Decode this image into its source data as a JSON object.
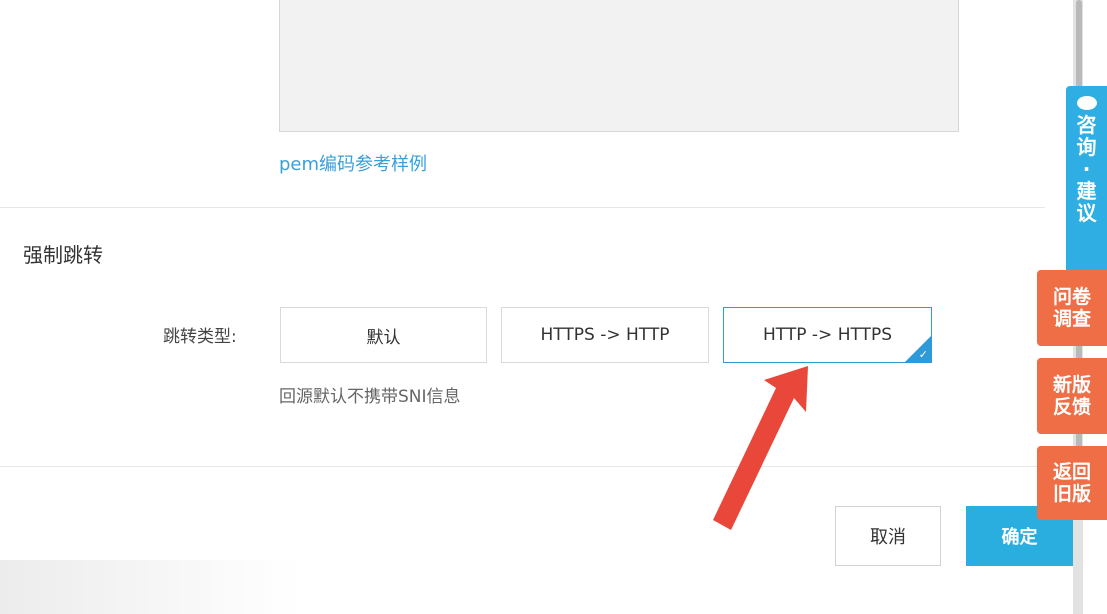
{
  "cert_form": {
    "pem_link": "pem编码参考样例"
  },
  "redirect": {
    "section_title": "强制跳转",
    "type_label": "跳转类型:",
    "options": [
      "默认",
      "HTTPS -> HTTP",
      "HTTP -> HTTPS"
    ],
    "selected": "HTTP -> HTTPS",
    "hint": "回源默认不携带SNI信息"
  },
  "footer": {
    "cancel_label": "取消",
    "ok_label": "确定"
  },
  "side_tools": {
    "consult_label": "咨询·建议",
    "survey_label": "问卷调查",
    "feedback_label": "新版反馈",
    "old_version_label": "返回旧版"
  },
  "colors": {
    "accent": "#2aaee0",
    "selected_border": "#2f9ad8",
    "side_orange": "#ef6e46",
    "annotation_arrow": "#e8473a"
  }
}
